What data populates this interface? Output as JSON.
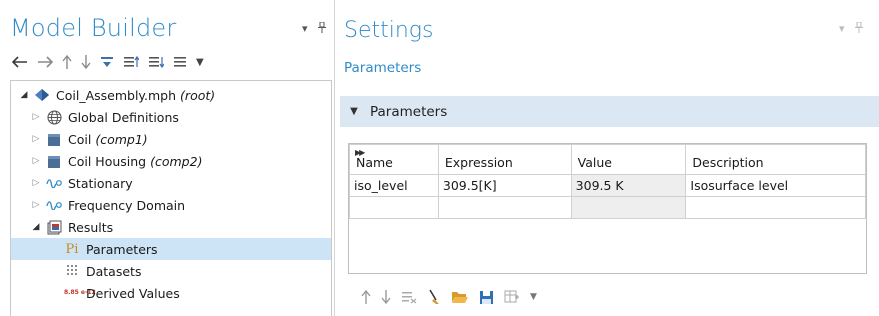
{
  "model_builder": {
    "title": "Model Builder",
    "toolbar": [
      "back-arrow-icon",
      "forward-arrow-icon",
      "move-up-icon",
      "move-down-icon",
      "show-icon",
      "collapse-all-icon",
      "expand-all-icon",
      "list-icon",
      "dropdown-icon"
    ],
    "tree": [
      {
        "label": "Coil_Assembly.mph",
        "suffix": "(root)",
        "icon": "model-root-icon",
        "expanded": true
      },
      {
        "label": "Global Definitions",
        "suffix": "",
        "icon": "globe-icon",
        "expanded": false
      },
      {
        "label": "Coil",
        "suffix": "(comp1)",
        "icon": "component-icon",
        "expanded": false
      },
      {
        "label": "Coil Housing",
        "suffix": "(comp2)",
        "icon": "component-icon",
        "expanded": false
      },
      {
        "label": "Stationary",
        "suffix": "",
        "icon": "study-icon",
        "expanded": false
      },
      {
        "label": "Frequency Domain",
        "suffix": "",
        "icon": "study-icon",
        "expanded": false
      },
      {
        "label": "Results",
        "suffix": "",
        "icon": "results-icon",
        "expanded": true
      },
      {
        "label": "Parameters",
        "suffix": "",
        "icon": "parameters-icon",
        "icon_text": "Pi",
        "selected": true
      },
      {
        "label": "Datasets",
        "suffix": "",
        "icon": "datasets-icon"
      },
      {
        "label": "Derived Values",
        "suffix": "",
        "icon": "derived-values-icon",
        "icon_text": "8.85 e-12"
      }
    ]
  },
  "settings": {
    "title": "Settings",
    "subtitle": "Parameters",
    "section_label": "Parameters",
    "table": {
      "headers": [
        "Name",
        "Expression",
        "Value",
        "Description"
      ],
      "rows": [
        [
          "iso_level",
          "309.5[K]",
          "309.5 K",
          "Isosurface level"
        ],
        [
          "",
          "",
          "",
          ""
        ]
      ]
    },
    "bottom_toolbar": [
      "move-up-icon",
      "move-down-icon",
      "delete-icon",
      "clear-icon",
      "open-file-icon",
      "save-icon",
      "load-table-icon",
      "dropdown-icon"
    ]
  },
  "colors": {
    "title_blue": "#2f8bc9",
    "selection": "#cde4f7",
    "section_bg": "#dbe8f4"
  }
}
